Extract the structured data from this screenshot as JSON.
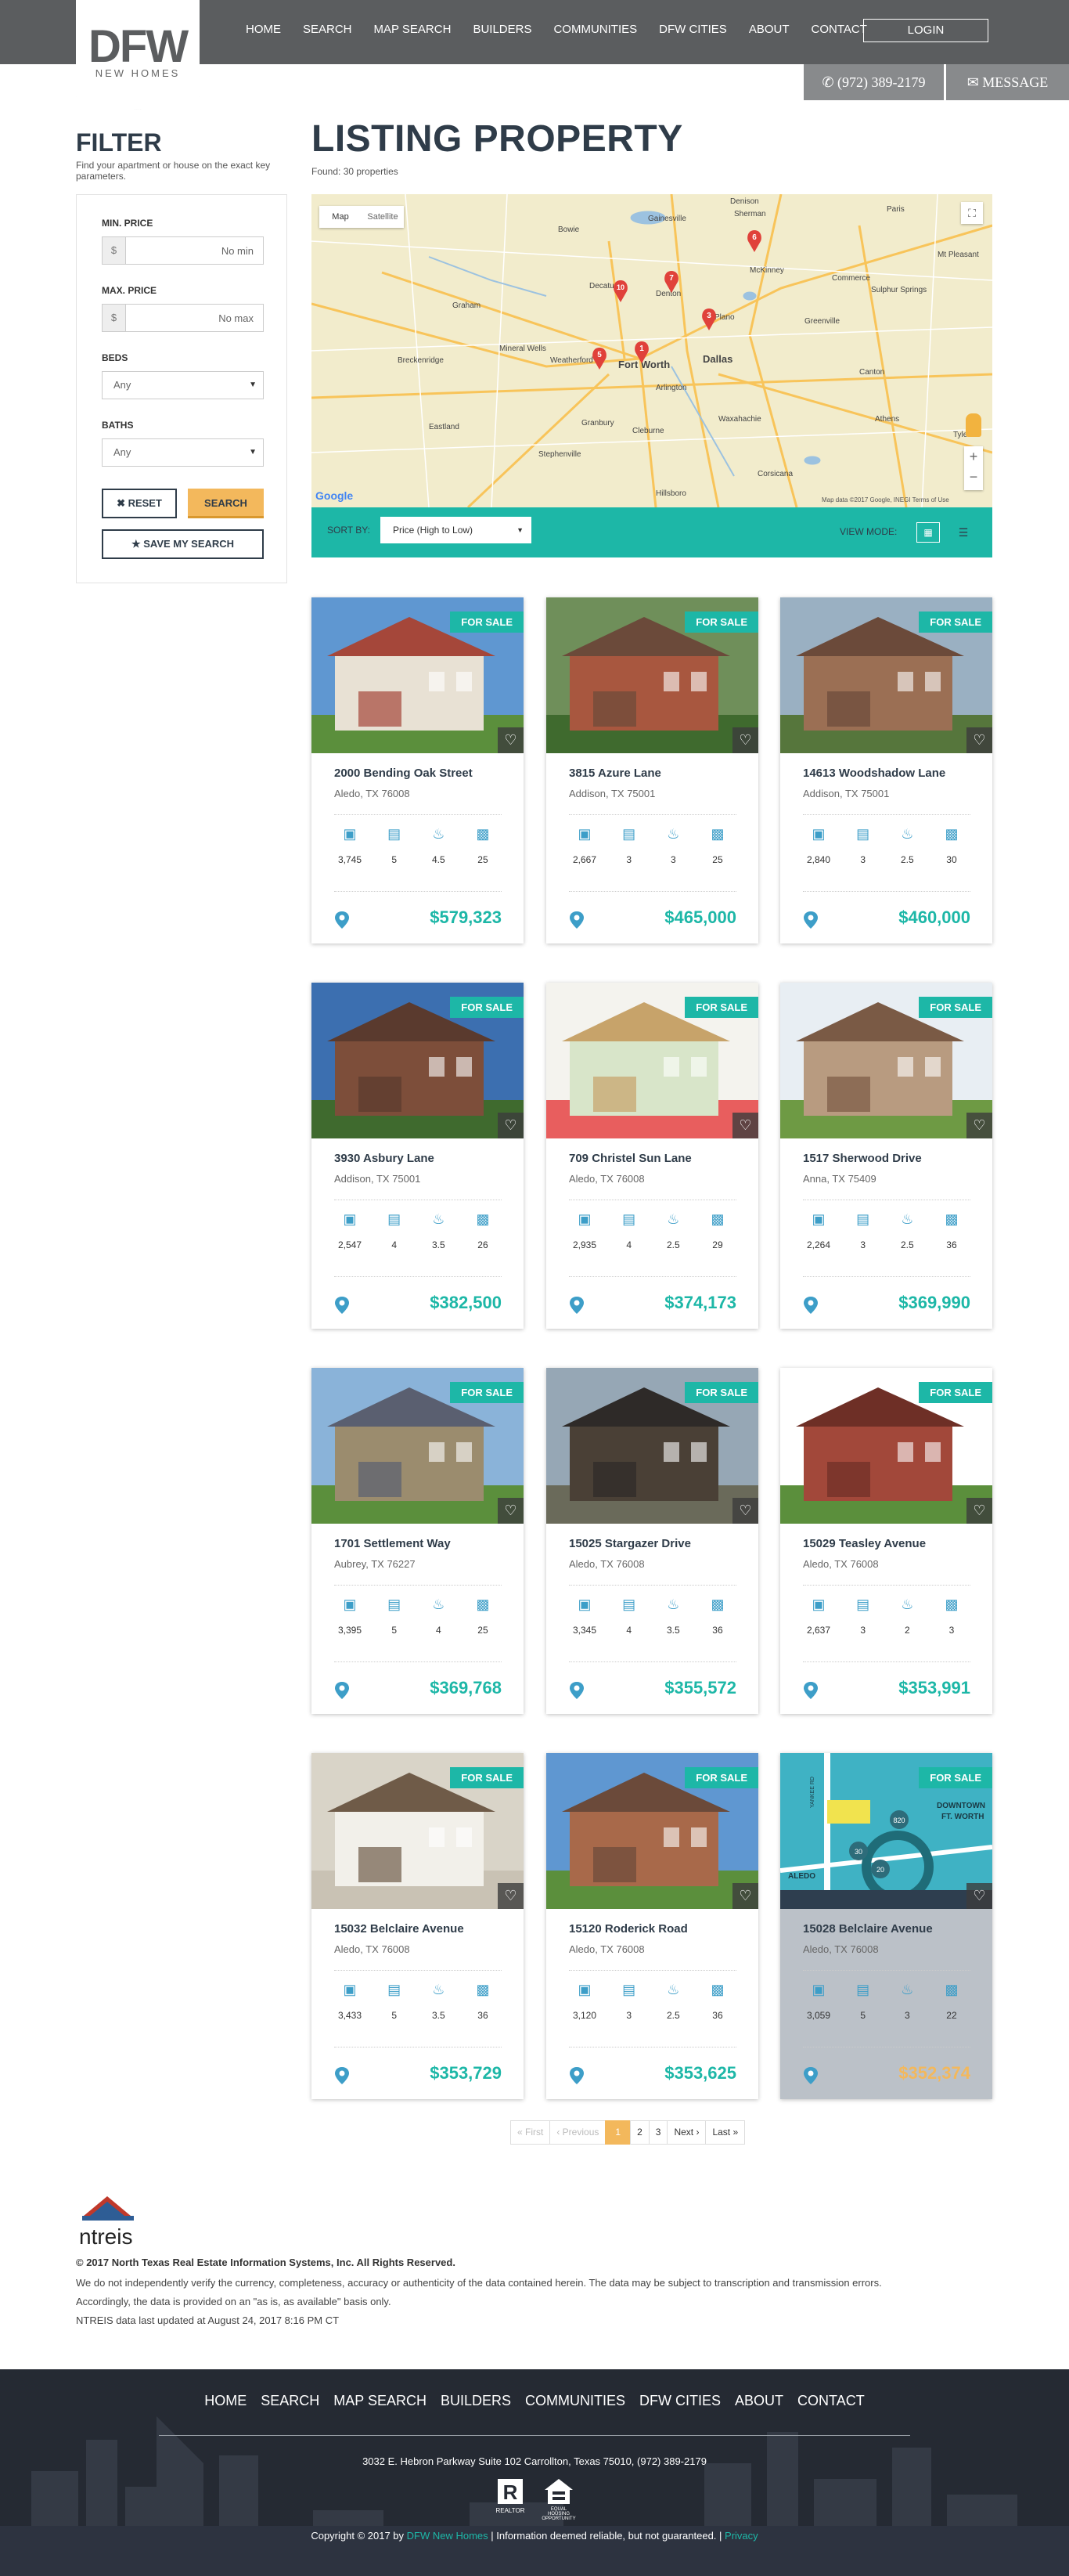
{
  "header": {
    "logo_main": "DFW",
    "logo_sub": "NEW HOMES",
    "nav": [
      "HOME",
      "SEARCH",
      "MAP SEARCH",
      "BUILDERS",
      "COMMUNITIES",
      "DFW CITIES",
      "ABOUT",
      "CONTACT"
    ],
    "login": "LOGIN",
    "phone": "(972) 389-2179",
    "message": "MESSAGE"
  },
  "filter": {
    "title": "FILTER",
    "description": "Find your apartment or house on the exact key parameters.",
    "min_price_label": "MIN. PRICE",
    "min_price_placeholder": "No min",
    "max_price_label": "MAX. PRICE",
    "max_price_placeholder": "No max",
    "currency": "$",
    "beds_label": "BEDS",
    "beds_value": "Any",
    "baths_label": "BATHS",
    "baths_value": "Any",
    "reset": "RESET",
    "search": "SEARCH",
    "save": "SAVE MY SEARCH"
  },
  "listing": {
    "title": "LISTING PROPERTY",
    "found": "Found: 30 properties"
  },
  "map": {
    "tab_map": "Map",
    "tab_satellite": "Satellite",
    "google": "Google",
    "credit": "Map data ©2017 Google, INEGI    Terms of Use",
    "cities": [
      "Denison",
      "Sherman",
      "Paris",
      "Gainesville",
      "Bowie",
      "Decatur",
      "McKinney",
      "Commerce",
      "Sulphur Springs",
      "Plano",
      "Greenville",
      "Denton",
      "Graham",
      "Mineral Wells",
      "Weatherford",
      "Fort Worth",
      "Dallas",
      "Arlington",
      "Breckenridge",
      "Granbury",
      "Cleburne",
      "Corsicana",
      "Waxahachie",
      "Athens",
      "Tyler",
      "Stephenville",
      "Eastland",
      "Hillsboro",
      "Canton",
      "Mt Pleasant"
    ],
    "markers": [
      "6",
      "7",
      "10",
      "3",
      "5",
      "1"
    ]
  },
  "sortbar": {
    "sort_label": "SORT BY:",
    "sort_value": "Price (High to Low)",
    "view_label": "VIEW MODE:"
  },
  "card_common": {
    "badge": "FOR SALE"
  },
  "cards": [
    {
      "address": "2000 Bending Oak Street",
      "city": "Aledo, TX 76008",
      "sqft": "3,745",
      "beds": "5",
      "baths": "4.5",
      "photos": "25",
      "price": "$579,323"
    },
    {
      "address": "3815 Azure Lane",
      "city": "Addison, TX 75001",
      "sqft": "2,667",
      "beds": "3",
      "baths": "3",
      "photos": "25",
      "price": "$465,000"
    },
    {
      "address": "14613 Woodshadow Lane",
      "city": "Addison, TX 75001",
      "sqft": "2,840",
      "beds": "3",
      "baths": "2.5",
      "photos": "30",
      "price": "$460,000"
    },
    {
      "address": "3930 Asbury Lane",
      "city": "Addison, TX 75001",
      "sqft": "2,547",
      "beds": "4",
      "baths": "3.5",
      "photos": "26",
      "price": "$382,500"
    },
    {
      "address": "709 Christel Sun Lane",
      "city": "Aledo, TX 76008",
      "sqft": "2,935",
      "beds": "4",
      "baths": "2.5",
      "photos": "29",
      "price": "$374,173"
    },
    {
      "address": "1517 Sherwood Drive",
      "city": "Anna, TX 75409",
      "sqft": "2,264",
      "beds": "3",
      "baths": "2.5",
      "photos": "36",
      "price": "$369,990"
    },
    {
      "address": "1701 Settlement Way",
      "city": "Aubrey, TX 76227",
      "sqft": "3,395",
      "beds": "5",
      "baths": "4",
      "photos": "25",
      "price": "$369,768"
    },
    {
      "address": "15025 Stargazer Drive",
      "city": "Aledo, TX 76008",
      "sqft": "3,345",
      "beds": "4",
      "baths": "3.5",
      "photos": "36",
      "price": "$355,572"
    },
    {
      "address": "15029 Teasley Avenue",
      "city": "Aledo, TX 76008",
      "sqft": "2,637",
      "beds": "3",
      "baths": "2",
      "photos": "3",
      "price": "$353,991"
    },
    {
      "address": "15032 Belclaire Avenue",
      "city": "Aledo, TX 76008",
      "sqft": "3,433",
      "beds": "5",
      "baths": "3.5",
      "photos": "36",
      "price": "$353,729"
    },
    {
      "address": "15120 Roderick Road",
      "city": "Aledo, TX 76008",
      "sqft": "3,120",
      "beds": "3",
      "baths": "2.5",
      "photos": "36",
      "price": "$353,625"
    },
    {
      "address": "15028 Belclaire Avenue",
      "city": "Aledo, TX 76008",
      "sqft": "3,059",
      "beds": "5",
      "baths": "3",
      "photos": "22",
      "price": "$352,374"
    }
  ],
  "card9_map": {
    "label_downtown": "DOWNTOWN",
    "label_ftworth": "FT. WORTH",
    "label_aledo": "ALEDO",
    "label_rd": "YANKEE RD",
    "hwy1": "820",
    "hwy2": "20",
    "hwy3": "30"
  },
  "pager": [
    "« First",
    "‹ Previous",
    "1",
    "2",
    "3",
    "Next ›",
    "Last »"
  ],
  "disclaimer": {
    "logo_text": "ntreis",
    "bold": "© 2017 North Texas Real Estate Information Systems, Inc. All Rights Reserved.",
    "line1": "We do not independently verify the currency, completeness, accuracy or authenticity of the data contained herein. The data may be subject to transcription and transmission errors.",
    "line2": "Accordingly, the data is provided on an \"as is, as available\" basis only.",
    "line3": "NTREIS data last updated at August 24, 2017 8:16 PM CT"
  },
  "footer": {
    "nav": [
      "HOME",
      "SEARCH",
      "MAP SEARCH",
      "BUILDERS",
      "COMMUNITIES",
      "DFW CITIES",
      "ABOUT",
      "CONTACT"
    ],
    "address": "3032 E. Hebron Parkway Suite 102 Carrollton, Texas 75010, (972) 389-2179",
    "realtor": "REALTOR",
    "equal_housing": "EQUAL HOUSING OPPORTUNITY",
    "copy_prefix": "Copyright © 2017 by",
    "copy_brand": "DFW New Homes",
    "copy_mid": "| Information deemed reliable, but not guaranteed. |",
    "copy_privacy": "Privacy"
  },
  "colors": {
    "accent": "#1db7a7",
    "dark": "#2f3c49",
    "gold": "#f3b85c",
    "header": "#5b5d5f",
    "icon_blue": "#3d9ec8"
  }
}
